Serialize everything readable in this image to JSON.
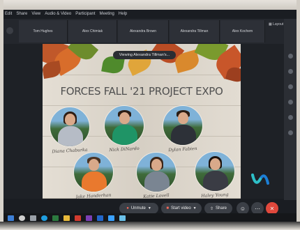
{
  "menu": {
    "items": [
      "Edit",
      "Share",
      "View",
      "Audio & Video",
      "Participant",
      "Meeting",
      "Help"
    ]
  },
  "participants": [
    "Tom Hughes",
    "Alex Chimiak",
    "Alexandra Brown",
    "Alexandra Tillman",
    "Alex Kochem"
  ],
  "layout_label": "Layout",
  "share_banner": "Viewing Alexandra Tillman's...",
  "slide": {
    "title": "FORCES FALL '21 PROJECT EXPO",
    "people": [
      {
        "name": "Diana Chaburka"
      },
      {
        "name": "Nick DiNardo"
      },
      {
        "name": "Dylan Fabien"
      },
      {
        "name": "Jake Handerhan"
      },
      {
        "name": "Katie Lovell"
      },
      {
        "name": "Haley Young"
      }
    ]
  },
  "toolbar": {
    "unmute": "Unmute",
    "start_video": "Start video",
    "share": "Share",
    "colors": {
      "muted": "#c0392b",
      "share": "#3b3f46",
      "leave": "#e0483c"
    }
  },
  "icons": [
    "microphone-icon",
    "camera-icon",
    "share-icon",
    "reactions-icon",
    "more-icon",
    "leave-icon",
    "webex-logo-icon",
    "layout-icon"
  ]
}
